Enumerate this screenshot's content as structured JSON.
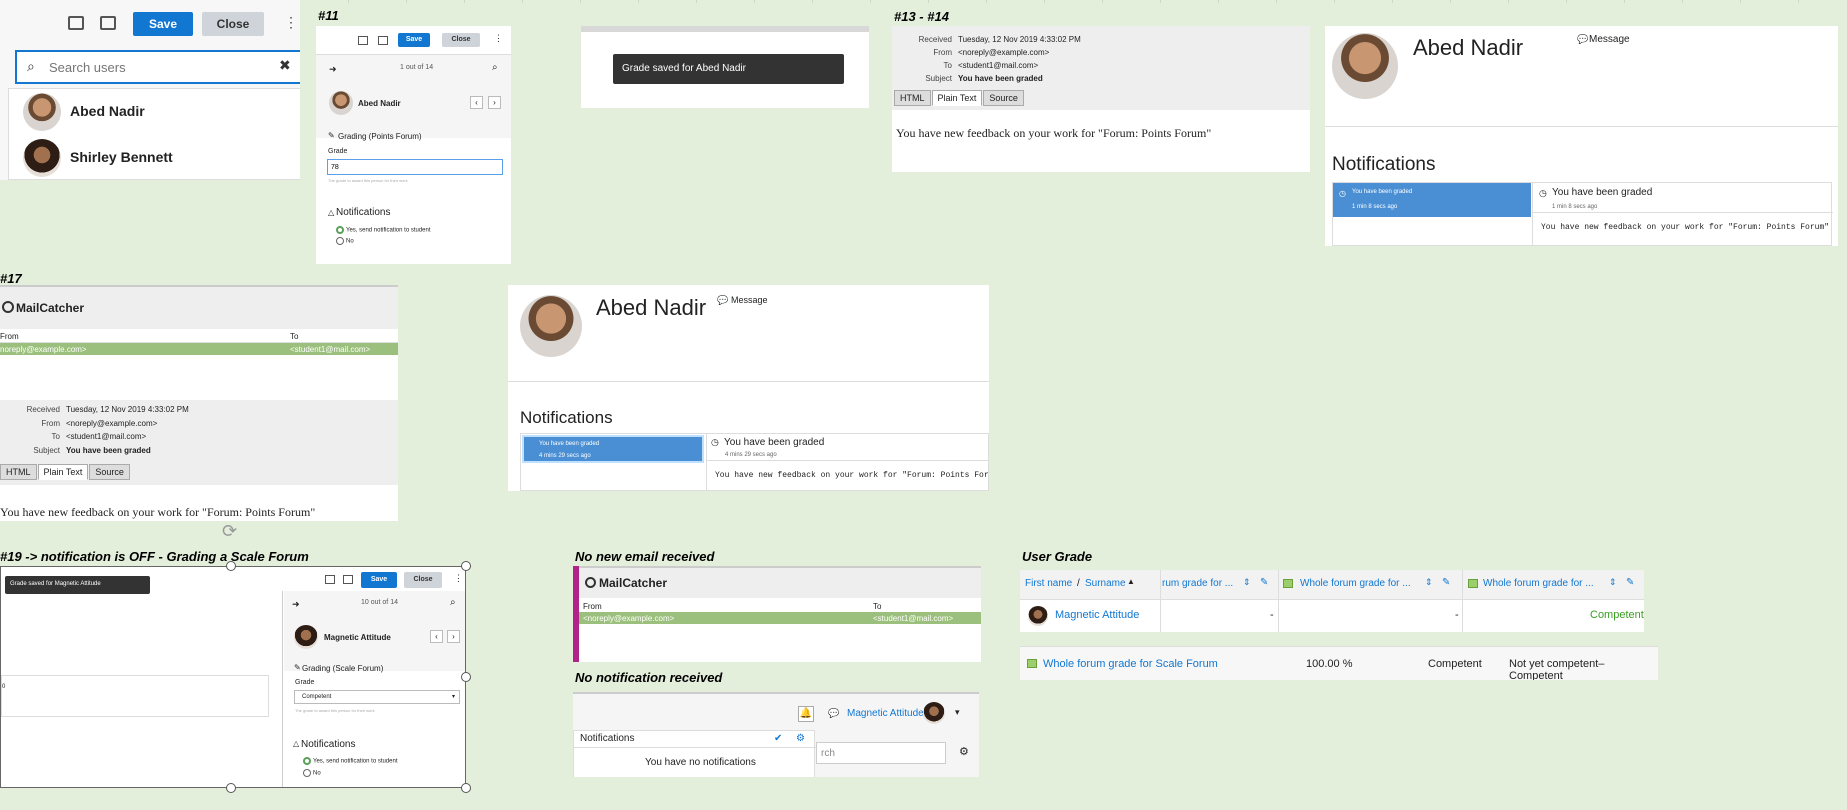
{
  "top_left": {
    "save": "Save",
    "close": "Close",
    "search_placeholder": "Search users",
    "users": [
      "Abed Nadir",
      "Shirley Bennett"
    ]
  },
  "p11": {
    "label": "#11",
    "save": "Save",
    "close": "Close",
    "counter": "1 out of 14",
    "user": "Abed Nadir",
    "grading_title": "Grading (Points Forum)",
    "grade_label": "Grade",
    "grade_value": "78",
    "grade_hint": "The grade to award this person for their work",
    "notifications_title": "Notifications",
    "opt_yes": "Yes, send notification to student",
    "opt_no": "No"
  },
  "toast1": {
    "text": "Grade saved for Abed Nadir"
  },
  "p13": {
    "label": "#13 - #14",
    "received_k": "Received",
    "received_v": "Tuesday, 12 Nov 2019 4:33:02 PM",
    "from_k": "From",
    "from_v": "<noreply@example.com>",
    "to_k": "To",
    "to_v": "<student1@mail.com>",
    "subject_k": "Subject",
    "subject_v": "You have been graded",
    "tabs": [
      "HTML",
      "Plain Text",
      "Source"
    ],
    "body": "You have new feedback on your work for \"Forum: Points Forum\""
  },
  "profile1": {
    "name": "Abed Nadir",
    "message": "Message",
    "notifications_title": "Notifications",
    "item_title": "You have been graded",
    "item_time": "1 min 8 secs ago",
    "detail_title": "You have been graded",
    "detail_time": "1 min 8 secs ago",
    "detail_body": "You have new feedback on your work for \"Forum: Points Forum\""
  },
  "p17": {
    "label": "#17",
    "app": "MailCatcher",
    "col_from": "From",
    "col_to": "To",
    "row_from": "noreply@example.com>",
    "row_to": "<student1@mail.com>",
    "received_k": "Received",
    "received_v": "Tuesday, 12 Nov 2019 4:33:02 PM",
    "from_k": "From",
    "from_v": "<noreply@example.com>",
    "to_k": "To",
    "to_v": "<student1@mail.com>",
    "subject_k": "Subject",
    "subject_v": "You have been graded",
    "tabs": [
      "HTML",
      "Plain Text",
      "Source"
    ],
    "body": "You have new feedback on your work for \"Forum: Points Forum\""
  },
  "profile2": {
    "name": "Abed Nadir",
    "message": "Message",
    "notifications_title": "Notifications",
    "item_title": "You have been graded",
    "item_time": "4 mins 29 secs ago",
    "detail_title": "You have been graded",
    "detail_time": "4 mins 29 secs ago",
    "detail_body": "You have new feedback on your work for \"Forum: Points Forum\""
  },
  "p19": {
    "label": "#19 -> notification is OFF - Grading a Scale Forum",
    "toast": "Grade saved for Magnetic Attitude",
    "save": "Save",
    "close": "Close",
    "counter": "10 out of 14",
    "user": "Magnetic Attitude",
    "grading_title": "Grading (Scale Forum)",
    "grade_label": "Grade",
    "grade_value": "Competent",
    "grade_hint": "The grade to award this person for their work",
    "notifications_title": "Notifications",
    "opt_yes": "Yes, send notification to student",
    "opt_no": "No",
    "left_fragment": "0"
  },
  "no_email": {
    "label": "No new email received",
    "app": "MailCatcher",
    "col_from": "From",
    "col_to": "To",
    "row_from": "<noreply@example.com>",
    "row_to": "<student1@mail.com>"
  },
  "no_notif": {
    "label": "No notification received",
    "user": "Magnetic Attitude",
    "notifications": "Notifications",
    "empty": "You have no notifications",
    "search_fragment": "rch"
  },
  "user_grade": {
    "label": "User Grade",
    "col_first": "First name",
    "col_sep": "/",
    "col_surname": "Surname",
    "col1": "rum grade for ...",
    "col2": "Whole forum grade for ...",
    "col3": "Whole forum grade for ...",
    "row_user": "Magnetic Attitude",
    "row_c1": "-",
    "row_c2": "-",
    "row_c3": "Competent",
    "summary_name": "Whole forum grade for Scale Forum",
    "summary_pct": "100.00 %",
    "summary_grade": "Competent",
    "summary_range": "Not yet competent–Competent"
  }
}
